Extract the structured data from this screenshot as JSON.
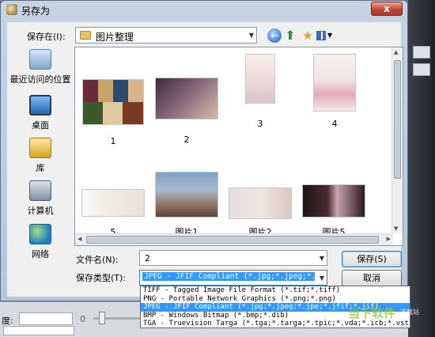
{
  "window": {
    "title": "另存为",
    "close_glyph": "x"
  },
  "save_in": {
    "label": "保存在(I):",
    "value": "图片整理"
  },
  "toolbar": {
    "back": "←",
    "up": "⬆",
    "new_folder": "★"
  },
  "places": [
    {
      "label": "最近访问的位置",
      "icon": "recent-places-icon"
    },
    {
      "label": "桌面",
      "icon": "desktop-icon"
    },
    {
      "label": "库",
      "icon": "library-icon"
    },
    {
      "label": "计算机",
      "icon": "computer-icon"
    },
    {
      "label": "网络",
      "icon": "network-icon"
    }
  ],
  "files": [
    {
      "name": "1"
    },
    {
      "name": "2"
    },
    {
      "name": "3"
    },
    {
      "name": "4"
    },
    {
      "name": "5"
    },
    {
      "name": "图片1"
    },
    {
      "name": "图片2"
    },
    {
      "name": "图片5"
    }
  ],
  "file_name": {
    "label": "文件名(N):",
    "value": "2"
  },
  "file_type": {
    "label": "保存类型(T):",
    "value": "JPEG - JFIF Compliant (*.jpg;*.jpeg;*.jpe",
    "options": [
      "TIFF - Tagged Image File Format (*.tif;*.tiff)",
      "PNG - Portable Network Graphics (*.png;*.png)",
      "JPEG - JFIF Compliant (*.jpg;*.jpeg;*.jpe;*.jfif;*.jif)",
      "BMP - Windows Bitmap (*.bmp;*.dib)",
      "TGA - Truevision Targa (*.tga;*.targa;*.tpic;*.vda;*.icb;*.vst)"
    ],
    "selected_index": 2
  },
  "buttons": {
    "save": "保存(S)",
    "cancel": "取消"
  },
  "background": {
    "setting_label": "度:",
    "value": "0"
  },
  "watermark": {
    "text": "当下软件",
    "sub": "下载站"
  }
}
